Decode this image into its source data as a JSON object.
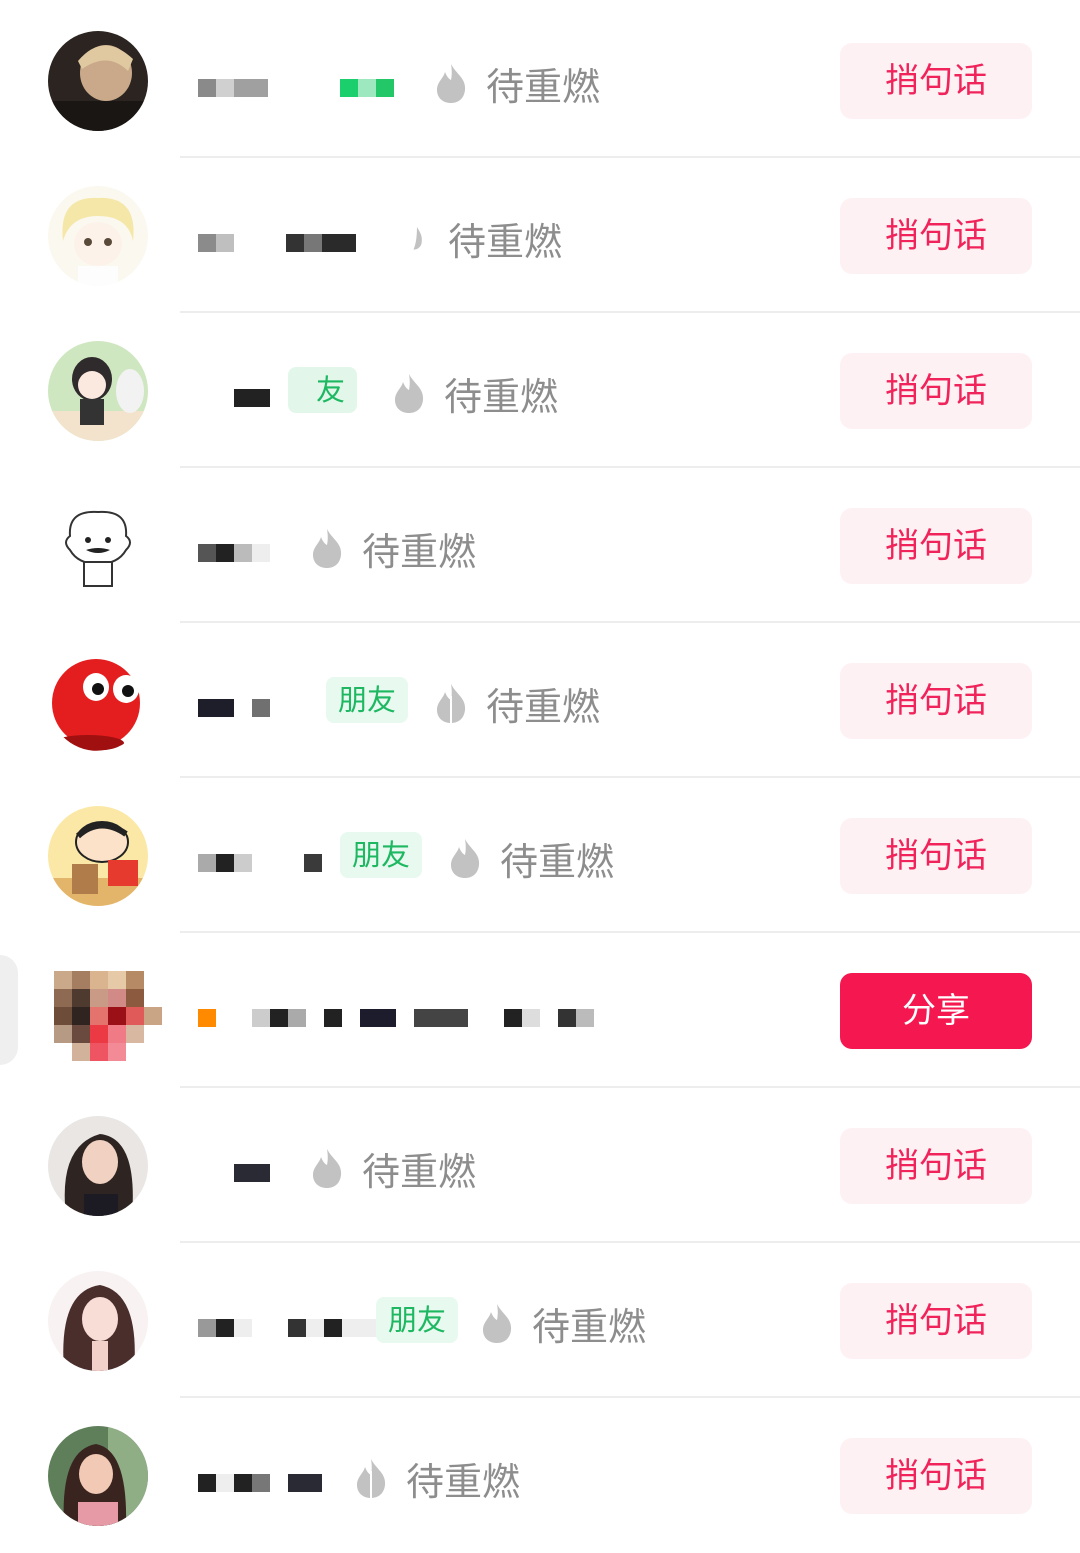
{
  "colors": {
    "accent": "#f0245a",
    "button_bg": "#fdf1f4",
    "share_bg": "#f5174f",
    "friend_tag_bg": "#e8f9ef",
    "friend_tag_text": "#1db861",
    "status_text": "#8d8d8d",
    "divider": "#ededed"
  },
  "rows": [
    {
      "friend_tag": "",
      "status": "待重燃",
      "action": "捎句话",
      "icon": "flame-icon"
    },
    {
      "friend_tag": "",
      "status": "待重燃",
      "action": "捎句话",
      "icon": "flame-icon"
    },
    {
      "friend_tag": "友",
      "status": "待重燃",
      "action": "捎句话",
      "icon": "flame-icon"
    },
    {
      "friend_tag": "",
      "status": "待重燃",
      "action": "捎句话",
      "icon": "flame-icon"
    },
    {
      "friend_tag": "朋友",
      "status": "待重燃",
      "action": "捎句话",
      "icon": "flame-icon"
    },
    {
      "friend_tag": "朋友",
      "status": "待重燃",
      "action": "捎句话",
      "icon": "flame-icon"
    },
    {
      "friend_tag": "",
      "status": "",
      "action": "分享",
      "icon": ""
    },
    {
      "friend_tag": "",
      "status": "待重燃",
      "action": "捎句话",
      "icon": "flame-icon"
    },
    {
      "friend_tag": "朋友",
      "status": "待重燃",
      "action": "捎句话",
      "icon": "flame-icon"
    },
    {
      "friend_tag": "",
      "status": "待重燃",
      "action": "捎句话",
      "icon": "flame-icon"
    }
  ]
}
